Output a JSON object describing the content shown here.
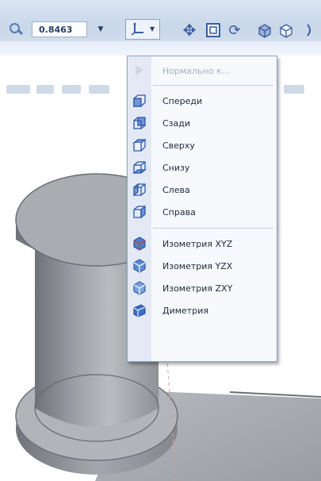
{
  "toolbar": {
    "zoom_value": "0.8463"
  },
  "menu": {
    "items": [
      {
        "label": "Нормально к...",
        "icon": "normal-to-icon",
        "enabled": false
      },
      {
        "label": "Спереди",
        "icon": "view-front-icon",
        "enabled": true
      },
      {
        "label": "Сзади",
        "icon": "view-back-icon",
        "enabled": true
      },
      {
        "label": "Сверху",
        "icon": "view-top-icon",
        "enabled": true
      },
      {
        "label": "Снизу",
        "icon": "view-bottom-icon",
        "enabled": true
      },
      {
        "label": "Слева",
        "icon": "view-left-icon",
        "enabled": true
      },
      {
        "label": "Справа",
        "icon": "view-right-icon",
        "enabled": true
      },
      {
        "label": "Изометрия XYZ",
        "icon": "isometric-xyz-icon",
        "enabled": true
      },
      {
        "label": "Изометрия YZX",
        "icon": "isometric-yzx-icon",
        "enabled": true
      },
      {
        "label": "Изометрия ZXY",
        "icon": "isometric-zxy-icon",
        "enabled": true
      },
      {
        "label": "Диметрия",
        "icon": "dimetric-icon",
        "enabled": true
      }
    ]
  },
  "colors": {
    "toolbar_bg": "#c9d7ea",
    "menu_bg": "#f7f9fc",
    "model_gray": "#8f9398",
    "accent_blue": "#3a5da0"
  }
}
